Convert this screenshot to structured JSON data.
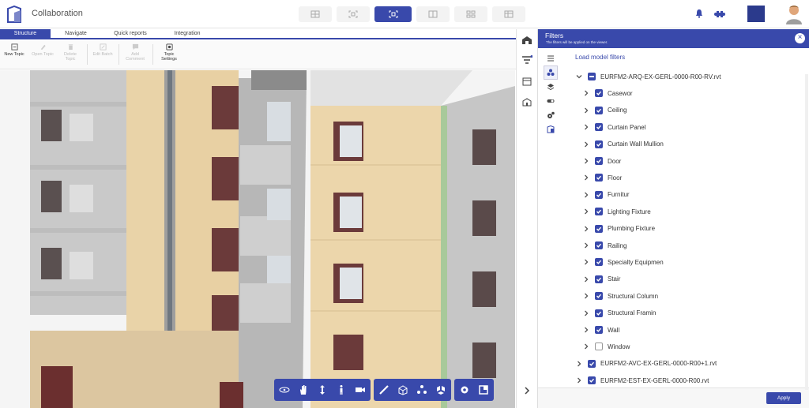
{
  "app": {
    "title": "Collaboration"
  },
  "views": [
    {
      "name": "view-single"
    },
    {
      "name": "view-split-horizontal"
    },
    {
      "name": "view-3d-model",
      "active": true
    },
    {
      "name": "view-2d-3d"
    },
    {
      "name": "view-quad"
    },
    {
      "name": "view-grid"
    }
  ],
  "tabs": [
    "Structure",
    "Navigate",
    "Quick reports",
    "Integration"
  ],
  "ribbon": {
    "new_topic": "New Topic",
    "open_topic": "Open Topic",
    "delete_topic": "Delete Topic",
    "edit_batch": "Edit Batch",
    "add_comment": "Add Comment",
    "topic_settings": "Topic Settings"
  },
  "filters": {
    "title": "Filters",
    "subtitle": "The filters will be applied on the viewer.",
    "load_model_filters": "Load model filters",
    "apply": "Apply",
    "models": [
      {
        "label": "EURFM2-ARQ-EX-GERL-0000-R00-RV.rvt",
        "expanded": true,
        "state": "partial",
        "categories": [
          {
            "label": "Casewor",
            "checked": true
          },
          {
            "label": "Ceiling",
            "checked": true
          },
          {
            "label": "Curtain Panel",
            "checked": true
          },
          {
            "label": "Curtain Wall Mullion",
            "checked": true
          },
          {
            "label": "Door",
            "checked": true
          },
          {
            "label": "Floor",
            "checked": true
          },
          {
            "label": "Furnitur",
            "checked": true
          },
          {
            "label": "Lighting Fixture",
            "checked": true
          },
          {
            "label": "Plumbing Fixture",
            "checked": true
          },
          {
            "label": "Railing",
            "checked": true
          },
          {
            "label": "Specialty Equipmen",
            "checked": true
          },
          {
            "label": "Stair",
            "checked": true
          },
          {
            "label": "Structural Column",
            "checked": true
          },
          {
            "label": "Structural Framin",
            "checked": true
          },
          {
            "label": "Wall",
            "checked": true
          },
          {
            "label": "Window",
            "checked": false
          }
        ]
      },
      {
        "label": "EURFM2-AVC-EX-GERL-0000-R00+1.rvt",
        "expanded": false,
        "state": "checked"
      },
      {
        "label": "EURFM2-EST-EX-GERL-0000-R00.rvt",
        "expanded": false,
        "state": "checked"
      }
    ]
  },
  "colors": {
    "accent": "#3949ab",
    "panel_bg": "#ffffff",
    "facade_beige": "#e8cfa4",
    "facade_grey": "#c4c4c4"
  }
}
